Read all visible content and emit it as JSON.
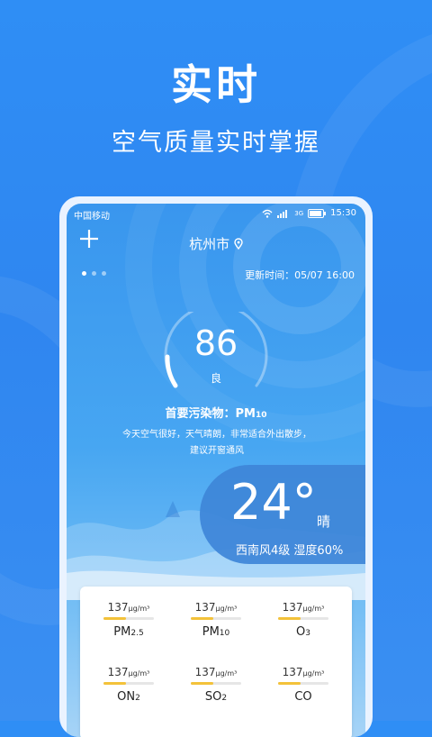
{
  "promo": {
    "title": "实时",
    "subtitle": "空气质量实时掌握"
  },
  "status_bar": {
    "carrier": "中国移动",
    "network": "3G",
    "time": "15:30"
  },
  "header": {
    "city": "杭州市",
    "add_icon": "plus-icon",
    "location_icon": "location-pin-icon"
  },
  "pager": {
    "count": 3,
    "active": 0
  },
  "update": {
    "label": "更新时间：",
    "time": "05/07 16:00"
  },
  "aqi": {
    "value": "86",
    "level": "良",
    "gauge_fraction": 0.25
  },
  "primary_pollutant": {
    "label": "首要污染物：",
    "name": "PM",
    "sub": "10"
  },
  "description": "今天空气很好，天气晴朗，非常适合外出散步，建议开窗通风",
  "weather": {
    "temperature": "24°",
    "condition": "晴",
    "wind": "西南风4级",
    "humidity": "湿度60%"
  },
  "pollutants": [
    {
      "value": "137",
      "unit": "μg/m³",
      "name": "PM",
      "sub": "2.5",
      "fraction": 0.45
    },
    {
      "value": "137",
      "unit": "μg/m³",
      "name": "PM",
      "sub": "10",
      "fraction": 0.45
    },
    {
      "value": "137",
      "unit": "μg/m³",
      "name": "O",
      "sub": "3",
      "fraction": 0.45
    },
    {
      "value": "137",
      "unit": "μg/m³",
      "name": "ON",
      "sub": "2",
      "fraction": 0.45
    },
    {
      "value": "137",
      "unit": "μg/m³",
      "name": "SO",
      "sub": "2",
      "fraction": 0.45
    },
    {
      "value": "137",
      "unit": "μg/m³",
      "name": "CO",
      "sub": "",
      "fraction": 0.45
    }
  ],
  "colors": {
    "background": "#2f8ef5",
    "gauge_active": "#ffffff",
    "bar_fill": "#f3c23a"
  }
}
